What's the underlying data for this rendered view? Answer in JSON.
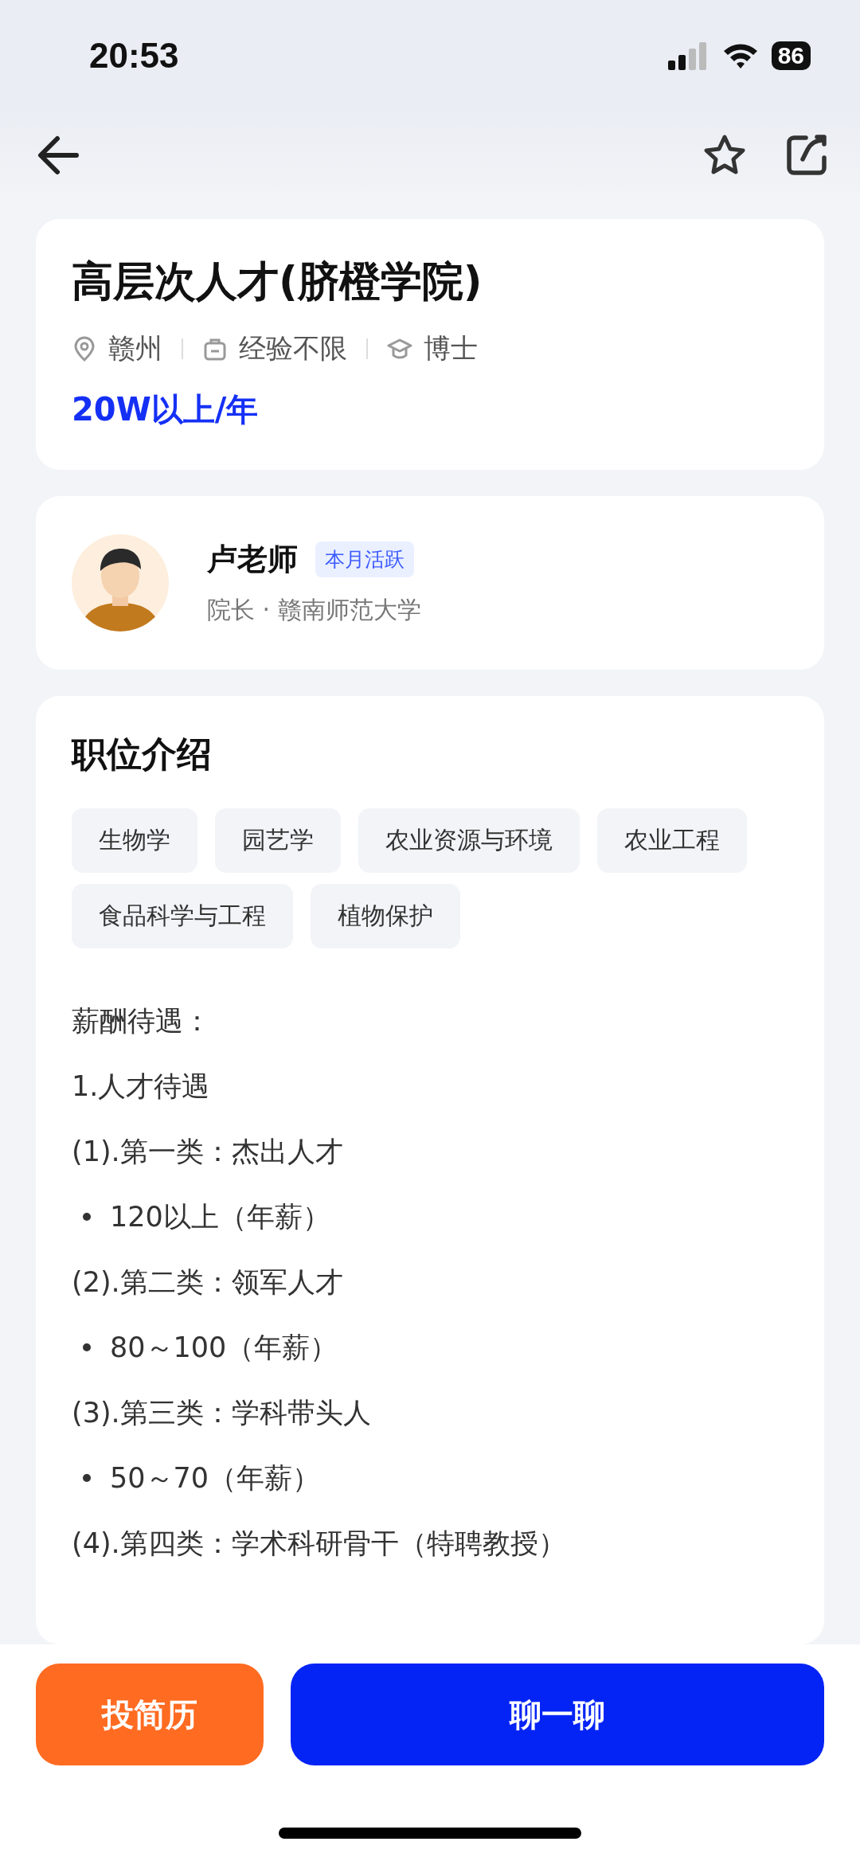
{
  "status_bar": {
    "time": "20:53",
    "battery": "86"
  },
  "job": {
    "title": "高层次人才(脐橙学院)",
    "meta": [
      {
        "kind": "location",
        "text": "赣州"
      },
      {
        "kind": "experience",
        "text": "经验不限"
      },
      {
        "kind": "education",
        "text": "博士"
      }
    ],
    "salary": "20W以上/年"
  },
  "recruiter": {
    "name": "卢老师",
    "badge": "本月活跃",
    "subtitle": "院长 · 赣南师范大学"
  },
  "description": {
    "heading": "职位介绍",
    "tags": [
      "生物学",
      "园艺学",
      "农业资源与环境",
      "农业工程",
      "食品科学与工程",
      "植物保护"
    ],
    "lines": [
      {
        "kind": "para",
        "text": "薪酬待遇："
      },
      {
        "kind": "para",
        "text": "1.人才待遇"
      },
      {
        "kind": "para",
        "text": "(1).第一类：杰出人才"
      },
      {
        "kind": "bullet",
        "text": "120以上（年薪）"
      },
      {
        "kind": "para",
        "text": "(2).第二类：领军人才"
      },
      {
        "kind": "bullet",
        "text": "80～100（年薪）"
      },
      {
        "kind": "para",
        "text": "(3).第三类：学科带头人"
      },
      {
        "kind": "bullet",
        "text": "50～70（年薪）"
      },
      {
        "kind": "para",
        "text": "(4).第四类：学术科研骨干（特聘教授）"
      }
    ]
  },
  "actions": [
    {
      "kind": "secondary",
      "label": "投简历"
    },
    {
      "kind": "primary",
      "label": "聊一聊"
    }
  ]
}
